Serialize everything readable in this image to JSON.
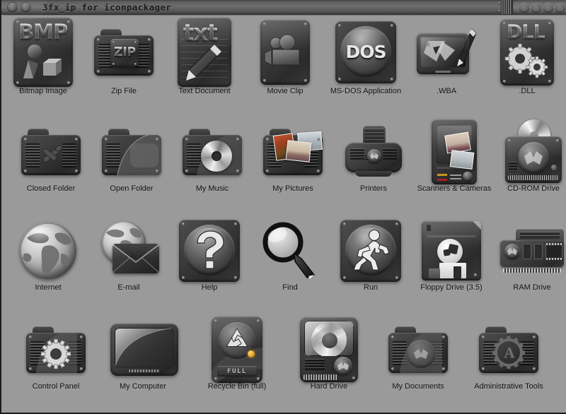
{
  "window": {
    "title": "3fx_ip for iconpackager",
    "left_buttons": [
      "titlebar-knob-1",
      "titlebar-knob-2"
    ],
    "right_buttons": [
      "titlebar-button-1",
      "titlebar-button-2",
      "titlebar-button-3",
      "titlebar-button-4"
    ],
    "grille": "titlebar-grille",
    "background_color": "#9a9a9a",
    "titlebar_color": "#6d6d6d",
    "frame_color": "#1c1c1c"
  },
  "icons": [
    {
      "label": "Bitmap Image",
      "name": "icon-bitmap-image",
      "art": "bmp"
    },
    {
      "label": "Zip File",
      "name": "icon-zip-file",
      "art": "zip"
    },
    {
      "label": "Text Document",
      "name": "icon-text-document",
      "art": "txt"
    },
    {
      "label": "Movie Clip",
      "name": "icon-movie-clip",
      "art": "movie"
    },
    {
      "label": "MS-DOS Application",
      "name": "icon-ms-dos-application",
      "art": "dos"
    },
    {
      "label": ".WBA",
      "name": "icon-wba",
      "art": "wba"
    },
    {
      "label": ".DLL",
      "name": "icon-dll",
      "art": "dll"
    },
    {
      "label": "Closed Folder",
      "name": "icon-closed-folder",
      "art": "folder-closed"
    },
    {
      "label": "Open Folder",
      "name": "icon-open-folder",
      "art": "folder-open"
    },
    {
      "label": "My Music",
      "name": "icon-my-music",
      "art": "folder-music"
    },
    {
      "label": "My Pictures",
      "name": "icon-my-pictures",
      "art": "folder-pictures"
    },
    {
      "label": "Printers",
      "name": "icon-printers",
      "art": "printer"
    },
    {
      "label": "Scanners & Cameras",
      "name": "icon-scanners-and-cameras",
      "art": "scanner"
    },
    {
      "label": "CD-ROM Drive",
      "name": "icon-cd-rom-drive",
      "art": "cdrom"
    },
    {
      "label": "Internet",
      "name": "icon-internet",
      "art": "globe"
    },
    {
      "label": "E-mail",
      "name": "icon-email",
      "art": "email"
    },
    {
      "label": "Help",
      "name": "icon-help",
      "art": "help"
    },
    {
      "label": "Find",
      "name": "icon-find",
      "art": "find"
    },
    {
      "label": "Run",
      "name": "icon-run",
      "art": "run"
    },
    {
      "label": "Floppy Drive (3.5)",
      "name": "icon-floppy-drive",
      "art": "floppy"
    },
    {
      "label": "RAM Drive",
      "name": "icon-ram-drive",
      "art": "ram"
    },
    {
      "label": "Control Panel",
      "name": "icon-control-panel",
      "art": "folder-gear"
    },
    {
      "label": "My Computer",
      "name": "icon-my-computer",
      "art": "monitor"
    },
    {
      "label": "Recycle Bin (full)",
      "name": "icon-recycle-bin-full",
      "art": "recycle"
    },
    {
      "label": "Hard Drive",
      "name": "icon-hard-drive",
      "art": "harddrive"
    },
    {
      "label": "My Documents",
      "name": "icon-my-documents",
      "art": "folder-docs"
    },
    {
      "label": "Administrative Tools",
      "name": "icon-administrative-tools",
      "art": "folder-admin"
    }
  ],
  "glyphs": {
    "bmp": "BMP",
    "zip": "ZIP",
    "txt": "txt",
    "dos": "DOS",
    "dll": "DLL",
    "admin": "A",
    "recycle_status": "FULL"
  },
  "accents": {
    "recycle_led": "#e8a31e",
    "scanner_led_amber": "#c8951f",
    "scanner_led_red": "#a8211d",
    "photo_warm": "#b44f2a",
    "photo_sky": "#cfbfa8",
    "metal_light": "#d8d8d8"
  }
}
